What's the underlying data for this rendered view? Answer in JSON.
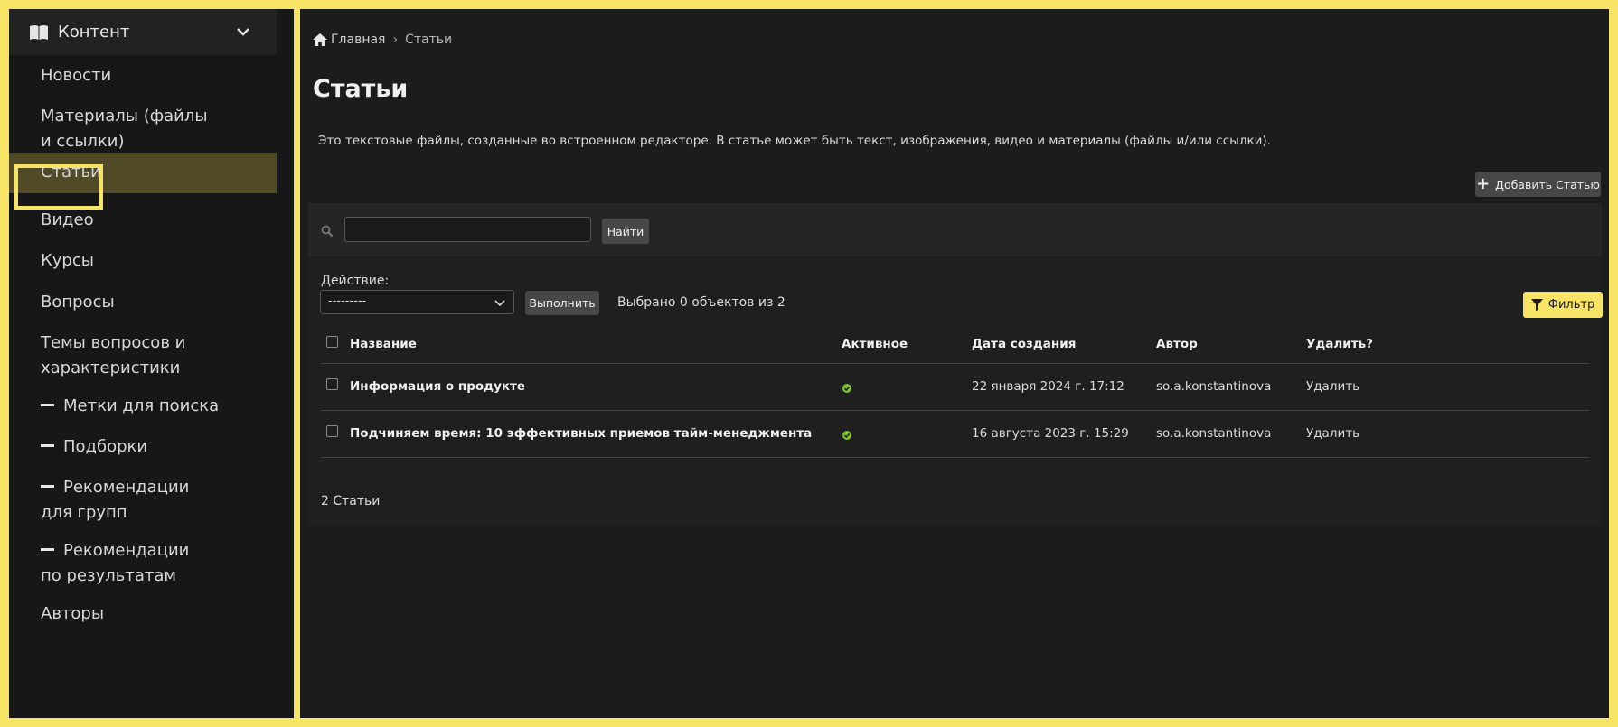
{
  "sidebar": {
    "section_title": "Контент",
    "items": [
      {
        "label": "Новости"
      },
      {
        "label": "Материалы (файлы и ссылки)"
      },
      {
        "label": "Статьи"
      },
      {
        "label": "Видео"
      },
      {
        "label": "Курсы"
      },
      {
        "label": "Вопросы"
      },
      {
        "label": "Темы вопросов и характеристики"
      },
      {
        "label": "Метки для поиска"
      },
      {
        "label": "Подборки"
      },
      {
        "label": "Рекомендации для групп"
      },
      {
        "label": "Рекомендации по результатам"
      },
      {
        "label": "Авторы"
      }
    ],
    "active_item": "Статьи"
  },
  "breadcrumb": {
    "home": "Главная",
    "separator": "›",
    "current": "Статьи"
  },
  "page": {
    "title": "Статьи",
    "description": "Это текстовые файлы, созданные во встроенном редакторе. В статье может быть текст, изображения, видео и материалы (файлы и/или ссылки).",
    "add_button": "Добавить Статью"
  },
  "search": {
    "value": "",
    "button": "Найти"
  },
  "actions": {
    "label": "Действие:",
    "selected": "---------",
    "run_button": "Выполнить",
    "selection_text": "Выбрано 0 объектов из 2",
    "filter_button": "Фильтр"
  },
  "table": {
    "headers": {
      "name": "Название",
      "active": "Активное",
      "created": "Дата создания",
      "author": "Автор",
      "delete": "Удалить?"
    },
    "rows": [
      {
        "name": "Информация о продукте",
        "active": true,
        "created": "22 января 2024 г. 17:12",
        "author": "so.a.konstantinova",
        "delete": "Удалить"
      },
      {
        "name": "Подчиняем время: 10 эффективных приемов тайм-менеджмента",
        "active": true,
        "created": "16 августа 2023 г. 15:29",
        "author": "so.a.konstantinova",
        "delete": "Удалить"
      }
    ],
    "footer": "2 Статьи"
  },
  "colors": {
    "accent": "#f7e464",
    "active_bg": "#504a27",
    "ok_green": "#7cc62a"
  }
}
